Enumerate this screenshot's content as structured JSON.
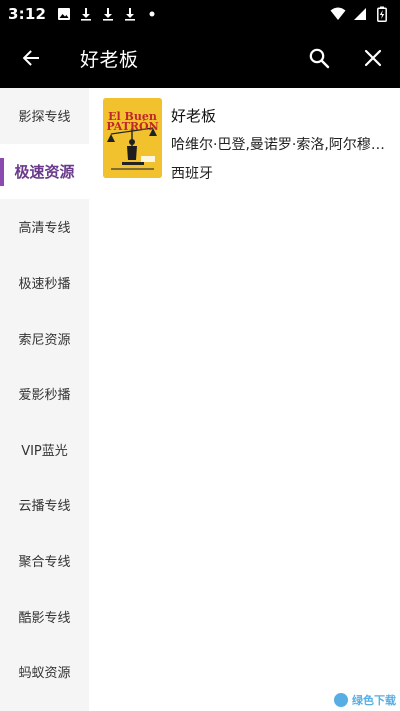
{
  "status_bar": {
    "time": "3:12",
    "left_icons": [
      "image-icon",
      "download-icon",
      "download-icon",
      "download-icon",
      "dot-icon"
    ],
    "right_icons": [
      "wifi-icon",
      "signal-icon",
      "battery-charging-icon"
    ]
  },
  "app_bar": {
    "title": "好老板",
    "back_icon": "arrow-left-icon",
    "search_icon": "search-icon",
    "close_icon": "close-icon"
  },
  "sidebar": {
    "items": [
      {
        "label": "影探专线",
        "active": false
      },
      {
        "label": "极速资源",
        "active": true
      },
      {
        "label": "高清专线",
        "active": false
      },
      {
        "label": "极速秒播",
        "active": false
      },
      {
        "label": "索尼资源",
        "active": false
      },
      {
        "label": "爱影秒播",
        "active": false
      },
      {
        "label": "VIP蓝光",
        "active": false
      },
      {
        "label": "云播专线",
        "active": false
      },
      {
        "label": "聚合专线",
        "active": false
      },
      {
        "label": "酷影专线",
        "active": false
      },
      {
        "label": "蚂蚁资源",
        "active": false
      }
    ]
  },
  "results": [
    {
      "title": "好老板",
      "cast": "哈维尔·巴登,曼诺罗·索洛,阿尔穆德纳·阿莫",
      "region": "西班牙",
      "poster_text": "El Buen PATRÓN"
    }
  ],
  "watermark": {
    "text": "绿色下载"
  },
  "colors": {
    "accent": "#8b4ab0",
    "active_text": "#6b3a8c",
    "bar_bg": "#000000",
    "sidebar_bg": "#f5f5f5",
    "poster_bg": "#f2c12e"
  }
}
